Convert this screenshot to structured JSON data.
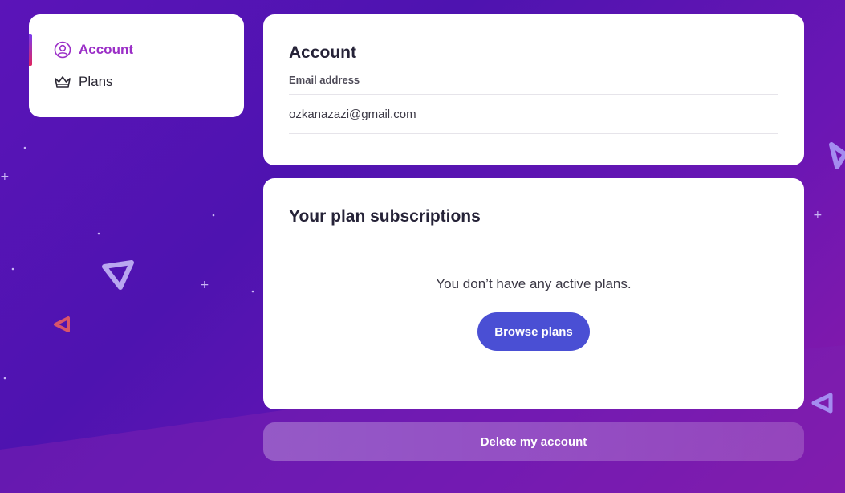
{
  "sidebar": {
    "items": [
      {
        "label": "Account",
        "icon": "user-circle-icon",
        "active": true
      },
      {
        "label": "Plans",
        "icon": "crown-icon",
        "active": false
      }
    ]
  },
  "account": {
    "title": "Account",
    "email_label": "Email address",
    "email_value": "ozkanazazi@gmail.com"
  },
  "plans": {
    "title": "Your plan subscriptions",
    "empty_message": "You don’t have any active plans.",
    "browse_label": "Browse plans"
  },
  "delete_label": "Delete my account",
  "colors": {
    "accent": "#9b2fc7",
    "button": "#4a4fd4",
    "background": "#5b14b8"
  }
}
